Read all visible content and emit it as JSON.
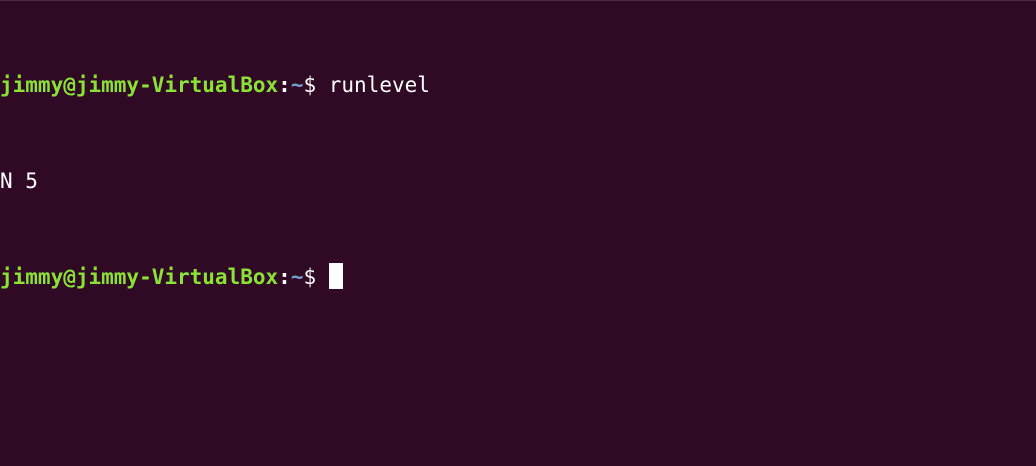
{
  "terminal": {
    "lines": [
      {
        "user_host": "jimmy@jimmy-VirtualBox",
        "separator": ":",
        "path": "~",
        "symbol": "$ ",
        "command": "runlevel"
      },
      {
        "output": "N 5"
      },
      {
        "user_host": "jimmy@jimmy-VirtualBox",
        "separator": ":",
        "path": "~",
        "symbol": "$ ",
        "command": ""
      }
    ],
    "colors": {
      "background": "#300a24",
      "user_host": "#8ae234",
      "path": "#729fcf",
      "text": "#ffffff"
    }
  }
}
